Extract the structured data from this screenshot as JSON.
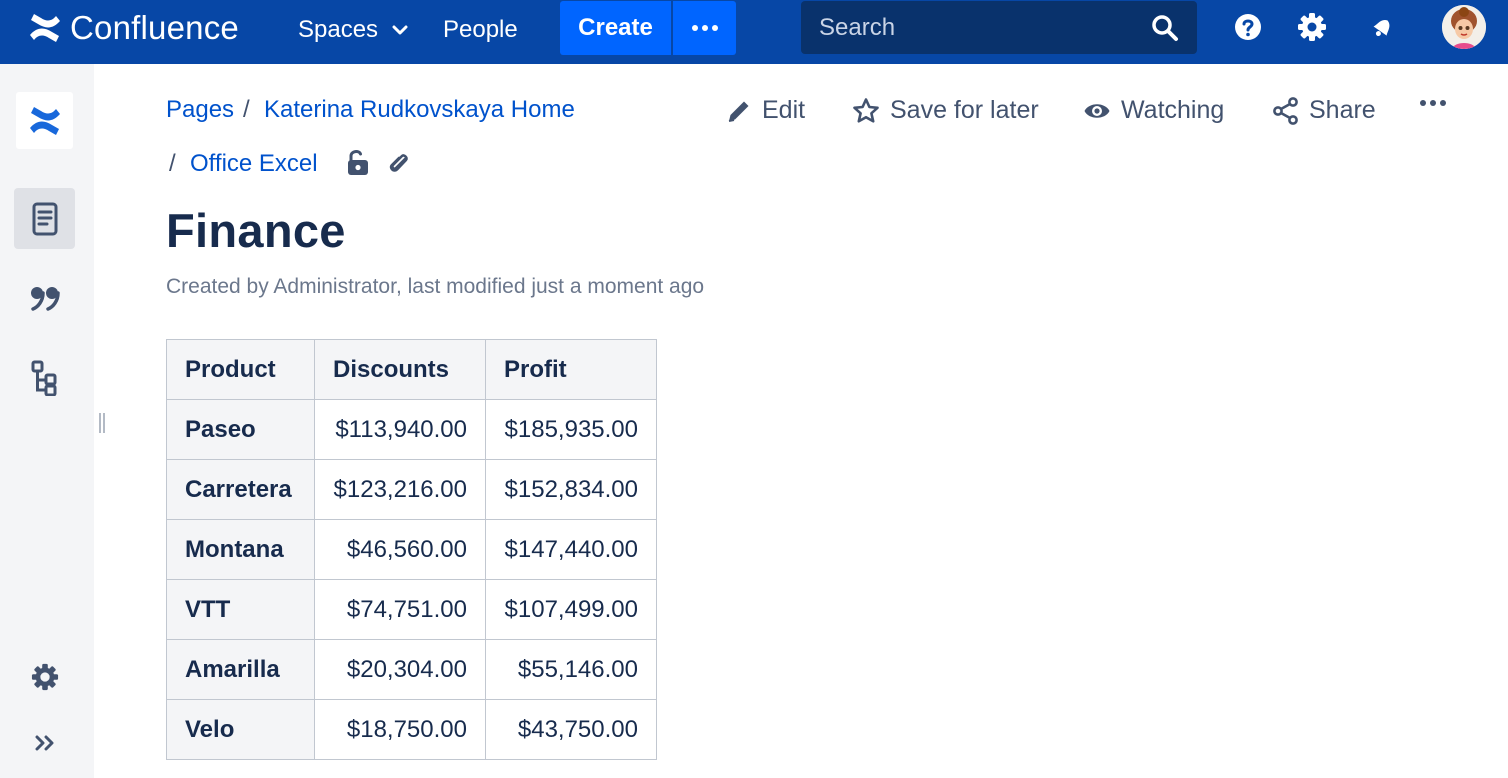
{
  "topbar": {
    "app_name": "Confluence",
    "spaces_label": "Spaces",
    "people_label": "People",
    "create_label": "Create",
    "search_placeholder": "Search",
    "icons": [
      "confluence-logo-icon",
      "chevron-down-icon",
      "more-icon",
      "search-icon",
      "help-icon",
      "gear-icon",
      "notification-icon",
      "avatar"
    ],
    "colors": {
      "bar": "#0747a6",
      "create": "#0065ff",
      "search": "#09326c"
    }
  },
  "sidebar": {
    "items": [
      {
        "name": "space-logo",
        "icon": "confluence-logo-icon"
      },
      {
        "name": "pages",
        "icon": "page-icon",
        "active": true
      },
      {
        "name": "blog",
        "icon": "quote-icon"
      },
      {
        "name": "page-tree",
        "icon": "tree-icon"
      },
      {
        "name": "space-settings",
        "icon": "gear-icon"
      },
      {
        "name": "expand",
        "icon": "double-chevron-right-icon"
      }
    ]
  },
  "breadcrumbs": [
    "Pages",
    "Katerina Rudkovskaya Home",
    "Office Excel"
  ],
  "breadcrumb_separator": "/",
  "page_actions": {
    "edit": "Edit",
    "save_for_later": "Save for later",
    "watching": "Watching",
    "share": "Share"
  },
  "page": {
    "title": "Finance",
    "byline": "Created by Administrator, last modified just a moment ago"
  },
  "table": {
    "headers": [
      "Product",
      "Discounts",
      "Profit"
    ],
    "rows": [
      [
        "Paseo",
        "$113,940.00",
        "$185,935.00"
      ],
      [
        "Carretera",
        "$123,216.00",
        "$152,834.00"
      ],
      [
        "Montana",
        "$46,560.00",
        "$147,440.00"
      ],
      [
        "VTT",
        "$74,751.00",
        "$107,499.00"
      ],
      [
        "Amarilla",
        "$20,304.00",
        "$55,146.00"
      ],
      [
        "Velo",
        "$18,750.00",
        "$43,750.00"
      ]
    ]
  }
}
